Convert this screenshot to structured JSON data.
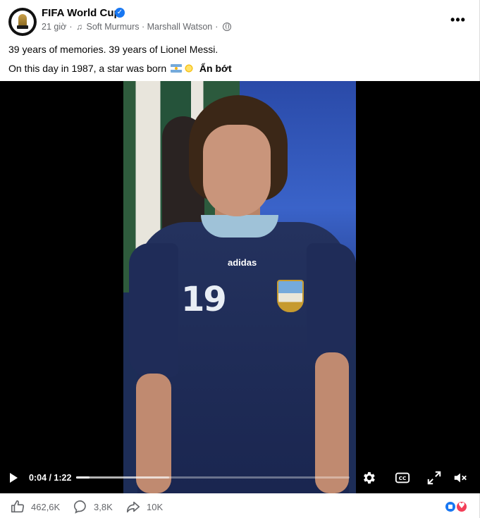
{
  "post": {
    "page_name": "FIFA World Cup",
    "verified": true,
    "time": "21 giờ",
    "separator": "·",
    "audio_label": "Soft Murmurs · Marshall Watson",
    "privacy_icon": "globe-icon",
    "more_icon": "more-icon",
    "more_label": "•••",
    "text_line1": "39 years of memories. 39 years of Lionel Messi.",
    "text_line2": "On this day in 1987, a star was born",
    "see_less": "Ẩn bớt"
  },
  "video": {
    "jersey_number": "19",
    "jersey_brand": "adidas",
    "current_time": "0:04",
    "duration": "1:22",
    "time_display": "0:04 / 1:22",
    "progress_fraction": 0.049,
    "buffered_fraction": 0.34,
    "controls": {
      "play_icon": "play-icon",
      "settings_icon": "gear-icon",
      "captions_icon": "cc-icon",
      "captions_label": "CC",
      "fullscreen_icon": "expand-icon",
      "mute_icon": "speaker-muted-icon"
    }
  },
  "footer": {
    "likes": "462,6K",
    "comments": "3,8K",
    "shares": "10K",
    "reaction_icons": [
      "like",
      "love"
    ]
  },
  "colors": {
    "accent": "#1877f2",
    "love": "#f33e58",
    "secondary_text": "#65676b"
  }
}
